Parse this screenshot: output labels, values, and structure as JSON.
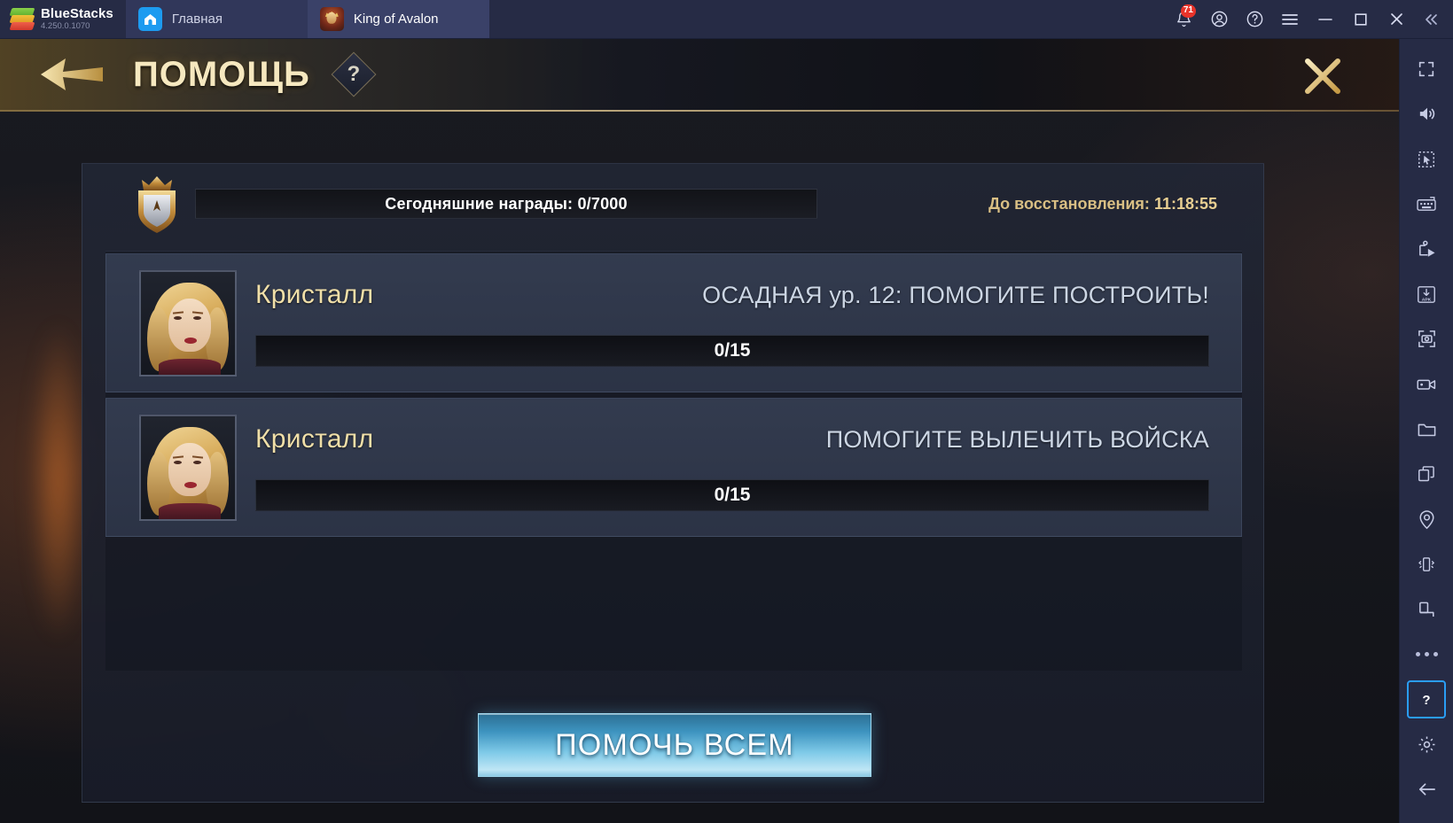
{
  "titlebar": {
    "brand": "BlueStacks",
    "version": "4.250.0.1070",
    "tabs": [
      {
        "label": "Главная",
        "icon": "home-icon",
        "active": false
      },
      {
        "label": "King of Avalon",
        "icon": "game-icon",
        "active": true
      }
    ],
    "tools": [
      {
        "name": "notifications-icon",
        "badge": "71"
      },
      {
        "name": "account-icon",
        "badge": ""
      },
      {
        "name": "help-icon",
        "badge": ""
      },
      {
        "name": "menu-icon",
        "badge": ""
      },
      {
        "name": "minimize-icon",
        "badge": ""
      },
      {
        "name": "maximize-icon",
        "badge": ""
      },
      {
        "name": "close-icon",
        "badge": ""
      },
      {
        "name": "collapse-icon",
        "badge": ""
      }
    ]
  },
  "game": {
    "header": {
      "back_label": "back-arrow",
      "title": "ПОМОЩЬ",
      "help_glyph": "?",
      "close_glyph": "close-x"
    },
    "summary": {
      "reward_text": "Сегодняшние награды: 0/7000",
      "recover_label": "До восстановления:",
      "recover_time": "11:18:55"
    },
    "requests": [
      {
        "player": "Кристалл",
        "task": "ОСАДНАЯ ур. 12: ПОМОГИТЕ ПОСТРОИТЬ!",
        "progress": "0/15"
      },
      {
        "player": "Кристалл",
        "task": "ПОМОГИТЕ ВЫЛЕЧИТЬ ВОЙСКА",
        "progress": "0/15"
      }
    ],
    "help_all_label": "ПОМОЧЬ ВСЕМ"
  },
  "sidebar": {
    "items": [
      {
        "name": "fullscreen-icon"
      },
      {
        "name": "volume-icon"
      },
      {
        "name": "cursor-select-icon"
      },
      {
        "name": "keyboard-controls-icon"
      },
      {
        "name": "macro-play-icon"
      },
      {
        "name": "install-apk-icon"
      },
      {
        "name": "screenshot-icon"
      },
      {
        "name": "record-video-icon"
      },
      {
        "name": "folder-icon"
      },
      {
        "name": "multi-instance-icon"
      },
      {
        "name": "location-pin-icon"
      },
      {
        "name": "shake-icon"
      },
      {
        "name": "rotate-screen-icon"
      },
      {
        "name": "more-options-icon"
      }
    ],
    "bottom_items": [
      {
        "name": "help-question-icon",
        "selected": true
      },
      {
        "name": "settings-gear-icon",
        "selected": false
      },
      {
        "name": "back-arrow-icon",
        "selected": false
      }
    ],
    "accent_color": "#2a9df4"
  },
  "colors": {
    "titlebar_bg": "#262b45",
    "active_tab_bg": "#3a4168",
    "gold_text": "#f0dfa8",
    "button_blue": "#7fcae8",
    "badge_red": "#e8332a"
  }
}
